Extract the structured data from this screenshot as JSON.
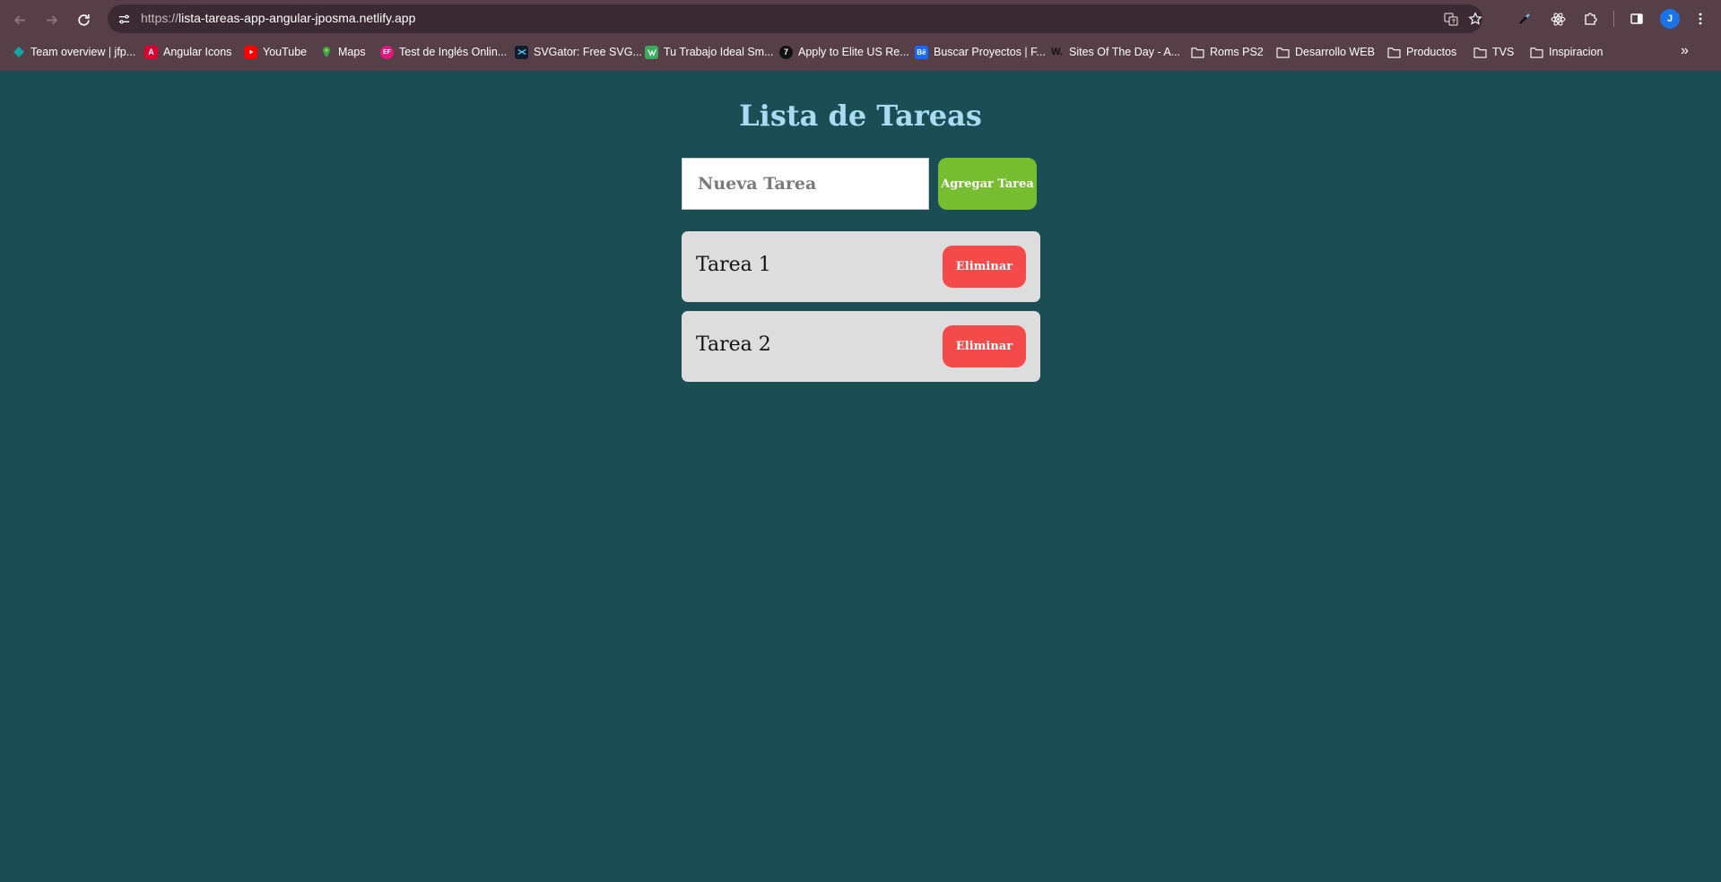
{
  "browser": {
    "url_protocol": "https://",
    "url_host": "lista-tareas-app-angular-jposma.netlify.app",
    "profile_initial": "J",
    "bookmarks": [
      {
        "label": "Team overview | jfp...",
        "icon": "diamond-icon",
        "color": "#16a5a5"
      },
      {
        "label": "Angular Icons",
        "icon": "angular-icon",
        "color": "#dd0031"
      },
      {
        "label": "YouTube",
        "icon": "youtube-icon",
        "color": "#ff0000"
      },
      {
        "label": "Maps",
        "icon": "maps-pin-icon",
        "color": "#34a853"
      },
      {
        "label": "Test de Inglés Onlin...",
        "icon": "ef-icon",
        "color": "#e6157e"
      },
      {
        "label": "SVGator: Free SVG...",
        "icon": "svgator-icon",
        "color": "#101c2c"
      },
      {
        "label": "Tu Trabajo Ideal Sm...",
        "icon": "workana-icon",
        "color": "#3aaa5c"
      },
      {
        "label": "Apply to Elite US Re...",
        "icon": "seven-icon",
        "color": "#111111"
      },
      {
        "label": "Buscar Proyectos | F...",
        "icon": "behance-icon",
        "color": "#1769ff"
      },
      {
        "label": "Sites Of The Day - A...",
        "icon": "awwwards-icon",
        "color": "#222222"
      },
      {
        "label": "Roms PS2",
        "icon": "folder-icon",
        "color": "#ffffff"
      },
      {
        "label": "Desarrollo WEB",
        "icon": "folder-icon",
        "color": "#ffffff"
      },
      {
        "label": "Productos",
        "icon": "folder-icon",
        "color": "#ffffff"
      },
      {
        "label": "TVS",
        "icon": "folder-icon",
        "color": "#ffffff"
      },
      {
        "label": "Inspiracion",
        "icon": "folder-icon",
        "color": "#ffffff"
      }
    ],
    "bookmark_glyphs": {
      "angular": "A",
      "ef": "EF",
      "seven": "7",
      "behance": "Bē",
      "awwwards": "W."
    }
  },
  "app": {
    "title": "Lista de Tareas",
    "input_placeholder": "Nueva Tarea",
    "add_button": "Agregar Tarea",
    "tasks": [
      {
        "label": "Tarea 1",
        "delete_button": "Eliminar"
      },
      {
        "label": "Tarea 2",
        "delete_button": "Eliminar"
      }
    ]
  },
  "colors": {
    "background": "#1b4d55",
    "title": "#a9dcf3",
    "add_button": "#76bd2f",
    "delete_button": "#f54a4a",
    "task_card": "#dddddd"
  }
}
